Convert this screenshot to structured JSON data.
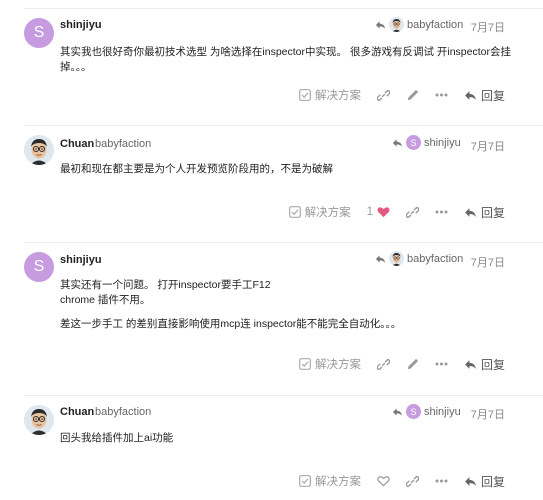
{
  "posts": [
    {
      "author": "shinjiyu",
      "username": "",
      "avatar_letter": "S",
      "avatar_type": "letter",
      "reply_to": "babyfaction",
      "reply_to_type": "cartoon",
      "date": "7月7日",
      "body": [
        "其实我也很好奇你最初技术选型 为啥选择在inspector中实现。 很多游戏有反调试 开inspector会挂掉。。。"
      ],
      "solution_label": "解决方案",
      "like_count": "",
      "reply_label": "回复"
    },
    {
      "author": "Chuan",
      "username": "babyfaction",
      "avatar_type": "cartoon",
      "reply_to": "shinjiyu",
      "reply_to_letter": "S",
      "reply_to_type": "letter",
      "date": "7月7日",
      "body": [
        "最初和现在都主要是为个人开发预览阶段用的，不是为破解"
      ],
      "solution_label": "解决方案",
      "like_count": "1",
      "reply_label": "回复"
    },
    {
      "author": "shinjiyu",
      "username": "",
      "avatar_letter": "S",
      "avatar_type": "letter",
      "reply_to": "babyfaction",
      "reply_to_type": "cartoon",
      "date": "7月7日",
      "body": [
        "其实还有一个问题。 打开inspector要手工F12",
        "chrome 插件不用。",
        "",
        "差这一步手工 的差别直接影响使用mcp连 inspector能不能完全自动化。。。"
      ],
      "solution_label": "解决方案",
      "like_count": "",
      "reply_label": "回复"
    },
    {
      "author": "Chuan",
      "username": "babyfaction",
      "avatar_type": "cartoon",
      "reply_to": "shinjiyu",
      "reply_to_letter": "S",
      "reply_to_type": "letter",
      "date": "7月7日",
      "body": [
        "回头我给插件加上ai功能"
      ],
      "solution_label": "解决方案",
      "like_count": "",
      "reply_label": "回复"
    }
  ],
  "colors": {
    "avatar_purple": "#c69be0",
    "like_heart": "#e45781",
    "muted": "#888888"
  }
}
